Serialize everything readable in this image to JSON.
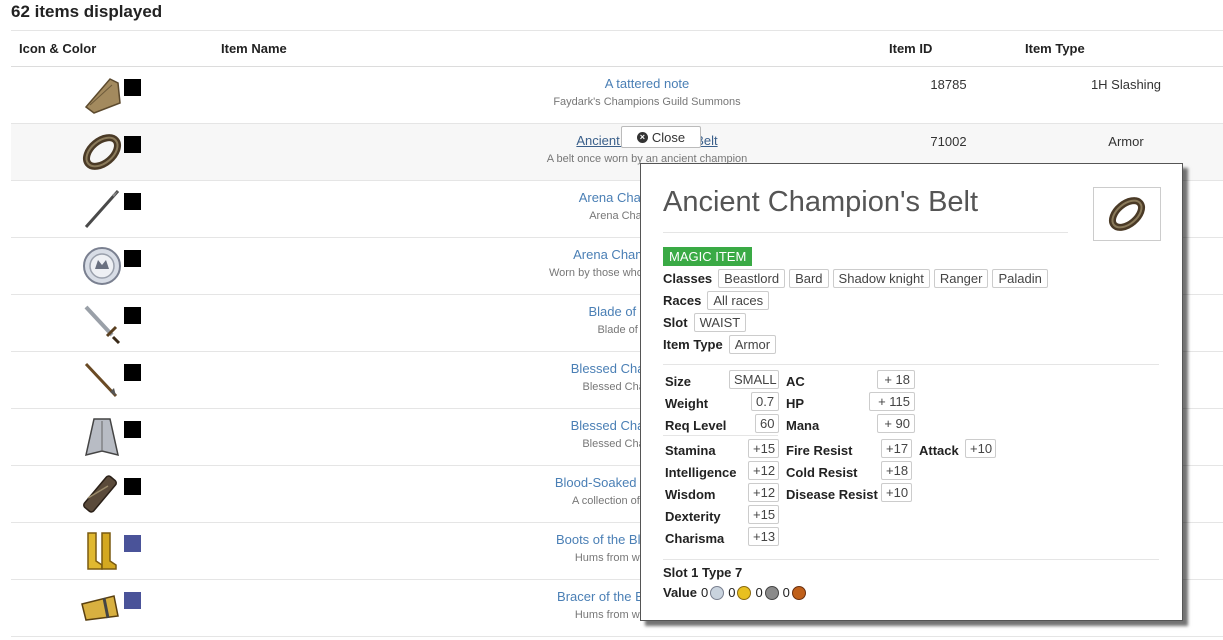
{
  "heading": "62 items displayed",
  "columns": {
    "icon": "Icon & Color",
    "name": "Item Name",
    "id": "Item ID",
    "type": "Item Type"
  },
  "rows": [
    {
      "name": "A tattered note",
      "desc": "Faydark's Champions Guild Summons",
      "id": "18785",
      "type": "1H Slashing",
      "icon": "note-icon",
      "swatch": "#000000"
    },
    {
      "name": "Ancient Champion's Belt",
      "desc": "A belt once worn by an ancient champion",
      "id": "71002",
      "type": "Armor",
      "icon": "belt-icon",
      "swatch": "#000000"
    },
    {
      "name": "Arena Champion Lance",
      "desc": "Arena Champion Lance",
      "id": "",
      "type": "",
      "icon": "lance-icon",
      "swatch": "#000000"
    },
    {
      "name": "Arena Champion's Badge",
      "desc": "Worn by those who have battled in the a",
      "id": "",
      "type": "",
      "icon": "badge-icon",
      "swatch": "#000000"
    },
    {
      "name": "Blade of Champions",
      "desc": "Blade of Champions",
      "id": "",
      "type": "",
      "icon": "sword-icon",
      "swatch": "#000000"
    },
    {
      "name": "Blessed Champion Arrows",
      "desc": "Blessed Champion Arrows",
      "id": "",
      "type": "",
      "icon": "arrow-icon",
      "swatch": "#000000"
    },
    {
      "name": "Blessed Champion's Cape",
      "desc": "Blessed Champion's Cape",
      "id": "",
      "type": "",
      "icon": "cape-icon",
      "swatch": "#000000"
    },
    {
      "name": "Blood-Soaked Champions Scrol",
      "desc": "A collection of a soldier's notes",
      "id": "",
      "type": "",
      "icon": "scroll-icon",
      "swatch": "#000000"
    },
    {
      "name": "Boots of the Blessed Champion",
      "desc": "Hums from within with energy",
      "id": "",
      "type": "",
      "icon": "boots-icon",
      "swatch": "#4a5399"
    },
    {
      "name": "Bracer of the Blessed Champio",
      "desc": "Hums from within with energy",
      "id": "",
      "type": "",
      "icon": "bracer-icon",
      "swatch": "#4a5399"
    }
  ],
  "close_label": "Close",
  "popup": {
    "title": "Ancient Champion's Belt",
    "badge": "MAGIC ITEM",
    "classes_label": "Classes",
    "classes": [
      "Beastlord",
      "Bard",
      "Shadow knight",
      "Ranger",
      "Paladin"
    ],
    "races_label": "Races",
    "races": "All races",
    "slot_label": "Slot",
    "slot": "WAIST",
    "itemtype_label": "Item Type",
    "itemtype": "Armor",
    "size_label": "Size",
    "size": "SMALL",
    "weight_label": "Weight",
    "weight": "0.7",
    "reqlevel_label": "Req Level",
    "reqlevel": "60",
    "ac_label": "AC",
    "ac": "+ 18",
    "hp_label": "HP",
    "hp": "+ 115",
    "mana_label": "Mana",
    "mana": "+ 90",
    "stamina_label": "Stamina",
    "stamina": "+15",
    "intelligence_label": "Intelligence",
    "intelligence": "+12",
    "wisdom_label": "Wisdom",
    "wisdom": "+12",
    "dexterity_label": "Dexterity",
    "dexterity": "+15",
    "charisma_label": "Charisma",
    "charisma": "+13",
    "fire_label": "Fire Resist",
    "fire": "+17",
    "cold_label": "Cold Resist",
    "cold": "+18",
    "disease_label": "Disease Resist",
    "disease": "+10",
    "attack_label": "Attack",
    "attack": "+10",
    "slot1": "Slot 1 Type 7",
    "value_label": "Value",
    "value_platinum": "0",
    "value_gold": "0",
    "value_silver": "0",
    "value_copper": "0",
    "coin_colors": {
      "platinum": "#c9d3de",
      "gold": "#e8c020",
      "silver": "#8a8a8a",
      "copper": "#c0601a"
    }
  }
}
